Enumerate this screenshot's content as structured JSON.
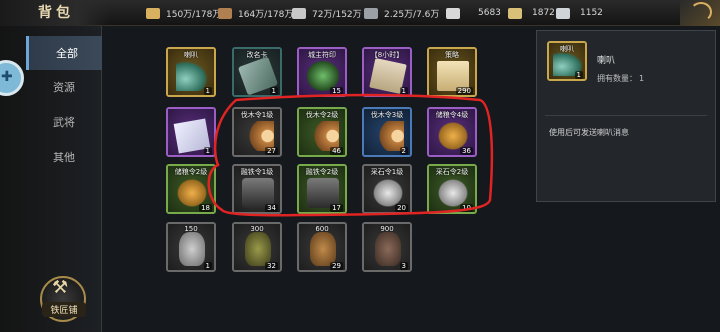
{
  "header": {
    "title": "背包",
    "resources": [
      {
        "icon": "wheat-icon",
        "value": "150万/178万",
        "color": "#d8b060"
      },
      {
        "icon": "log-icon",
        "value": "164万/178万",
        "color": "#b08050"
      },
      {
        "icon": "stone-icon",
        "value": "72万/152万",
        "color": "#c8c8c8"
      },
      {
        "icon": "iron-icon",
        "value": "2.25万/7.6万",
        "color": "#9aa0a6"
      },
      {
        "icon": "feather-icon",
        "value": "5683",
        "color": "#d8d8d8"
      },
      {
        "icon": "gold-ingot-icon",
        "value": "1872",
        "color": "#d8c078"
      },
      {
        "icon": "silver-ingot-icon",
        "value": "1152",
        "color": "#cfd4d8"
      }
    ]
  },
  "sidebar": {
    "tabs": [
      {
        "label": "全部",
        "active": true
      },
      {
        "label": "资源",
        "active": false
      },
      {
        "label": "武将",
        "active": false
      },
      {
        "label": "其他",
        "active": false
      }
    ],
    "blacksmith_label": "铁匠铺"
  },
  "items": [
    {
      "label": "喇叭",
      "count": "1",
      "rarity": "gold",
      "art": "horn"
    },
    {
      "label": "改名卡",
      "count": "1",
      "rarity": "teal",
      "art": "scroll"
    },
    {
      "label": "城主符印",
      "count": "15",
      "rarity": "purple",
      "art": "dragon"
    },
    {
      "label": "【8小时】",
      "count": "1",
      "rarity": "purple",
      "art": "letter"
    },
    {
      "label": "策略",
      "count": "290",
      "rarity": "gold",
      "art": "book"
    },
    {
      "label": "",
      "count": "1",
      "rarity": "purple",
      "art": "paper"
    },
    {
      "label": "伐木令1级",
      "count": "27",
      "rarity": "gray",
      "art": "log"
    },
    {
      "label": "伐木令2级",
      "count": "46",
      "rarity": "green",
      "art": "log"
    },
    {
      "label": "伐木令3级",
      "count": "2",
      "rarity": "blue",
      "art": "log"
    },
    {
      "label": "储粮令4级",
      "count": "36",
      "rarity": "purple",
      "art": "wheat"
    },
    {
      "label": "储粮令2级",
      "count": "18",
      "rarity": "green",
      "art": "wheat"
    },
    {
      "label": "融铁令1级",
      "count": "34",
      "rarity": "gray",
      "art": "ingot"
    },
    {
      "label": "融铁令2级",
      "count": "17",
      "rarity": "green",
      "art": "ingot"
    },
    {
      "label": "采石令1级",
      "count": "20",
      "rarity": "gray",
      "art": "stone"
    },
    {
      "label": "采石令2级",
      "count": "10",
      "rarity": "green",
      "art": "stone"
    },
    {
      "label": "150",
      "count": "1",
      "rarity": "gray",
      "art": "jar j1"
    },
    {
      "label": "300",
      "count": "32",
      "rarity": "gray",
      "art": "jar j2"
    },
    {
      "label": "600",
      "count": "29",
      "rarity": "gray",
      "art": "jar j3"
    },
    {
      "label": "900",
      "count": "3",
      "rarity": "gray",
      "art": "jar j4"
    }
  ],
  "detail": {
    "name": "喇叭",
    "icon_label": "喇叭",
    "icon_count": "1",
    "owned_label": "拥有数量：",
    "owned_value": "1",
    "description": "使用后可发送喇叭消息"
  },
  "colors": {
    "annotation": "#e02424",
    "active_tab": "#3b4959"
  }
}
